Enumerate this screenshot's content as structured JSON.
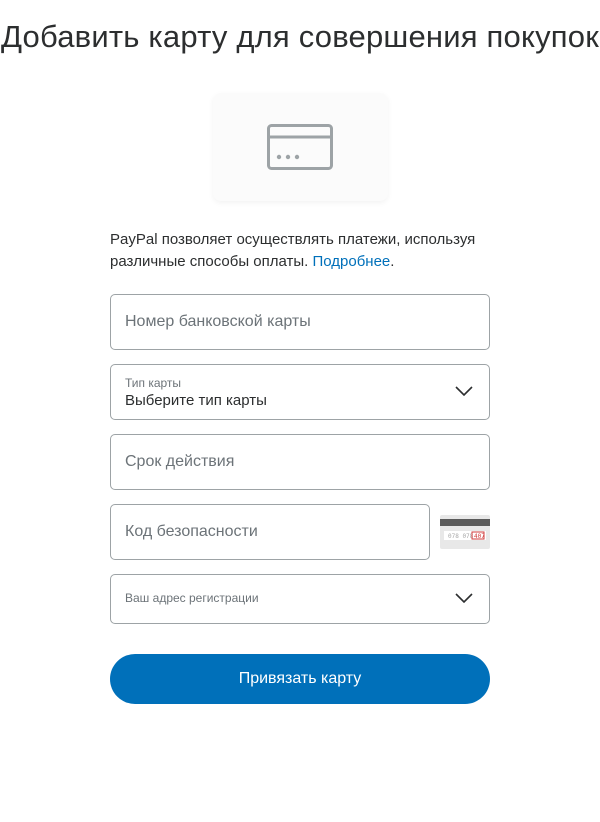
{
  "title": "Добавить карту для совершения покупок",
  "intro": {
    "text1": "PayPal позволяет осуществлять платежи, используя различные способы оплаты. ",
    "link": "Подробнее",
    "suffix": "."
  },
  "fields": {
    "cardNumber": {
      "placeholder": "Номер банковской карты",
      "value": ""
    },
    "cardType": {
      "label": "Тип карты",
      "value": "Выберите тип карты"
    },
    "expiry": {
      "placeholder": "Срок действия",
      "value": ""
    },
    "security": {
      "placeholder": "Код безопасности",
      "value": ""
    },
    "address": {
      "label": "Ваш адрес регистрации",
      "value": ""
    }
  },
  "submit": {
    "label": "Привязать карту"
  },
  "colors": {
    "accent": "#0070ba"
  }
}
